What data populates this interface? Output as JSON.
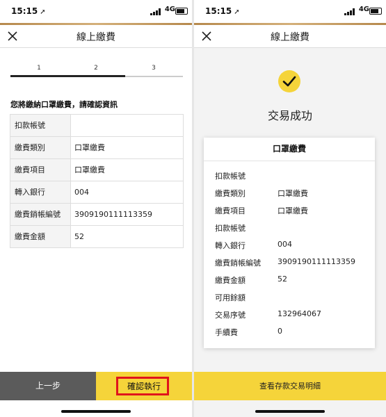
{
  "status": {
    "time": "15:15",
    "network": "4G"
  },
  "left": {
    "nav_title": "線上繳費",
    "steps": [
      "1",
      "2",
      "3"
    ],
    "heading": "您將繳納口罩繳費，請確認資訊",
    "rows": [
      {
        "label": "扣款帳號",
        "value": ""
      },
      {
        "label": "繳費類別",
        "value": "口罩繳費"
      },
      {
        "label": "繳費項目",
        "value": "口罩繳費"
      },
      {
        "label": "轉入銀行",
        "value": "004"
      },
      {
        "label": "繳費銷帳編號",
        "value": "3909190111113359"
      },
      {
        "label": "繳費金額",
        "value": "52"
      }
    ],
    "prev_label": "上一步",
    "confirm_label": "確認執行"
  },
  "right": {
    "nav_title": "線上繳費",
    "success_text": "交易成功",
    "card_title": "口罩繳費",
    "items": [
      {
        "label": "扣款帳號",
        "value": ""
      },
      {
        "label": "繳費類別",
        "value": "口罩繳費"
      },
      {
        "label": "繳費項目",
        "value": "口罩繳費"
      },
      {
        "label": "扣款帳號",
        "value": ""
      },
      {
        "label": "轉入銀行",
        "value": "004"
      },
      {
        "label": "繳費銷帳編號",
        "value": "3909190111113359"
      },
      {
        "label": "繳費金額",
        "value": "52"
      },
      {
        "label": "可用餘額",
        "value": ""
      },
      {
        "label": "交易序號",
        "value": "132964067"
      },
      {
        "label": "手續費",
        "value": "0"
      }
    ],
    "detail_button": "查看存款交易明細"
  },
  "colors": {
    "accent_yellow": "#f5d43a",
    "button_gray": "#5b5b5b",
    "highlight_red": "#e0141c",
    "gold_line": "#c9a46a"
  },
  "icons": [
    "close-icon",
    "check-icon",
    "location-arrow-icon",
    "signal-icon",
    "battery-icon"
  ]
}
